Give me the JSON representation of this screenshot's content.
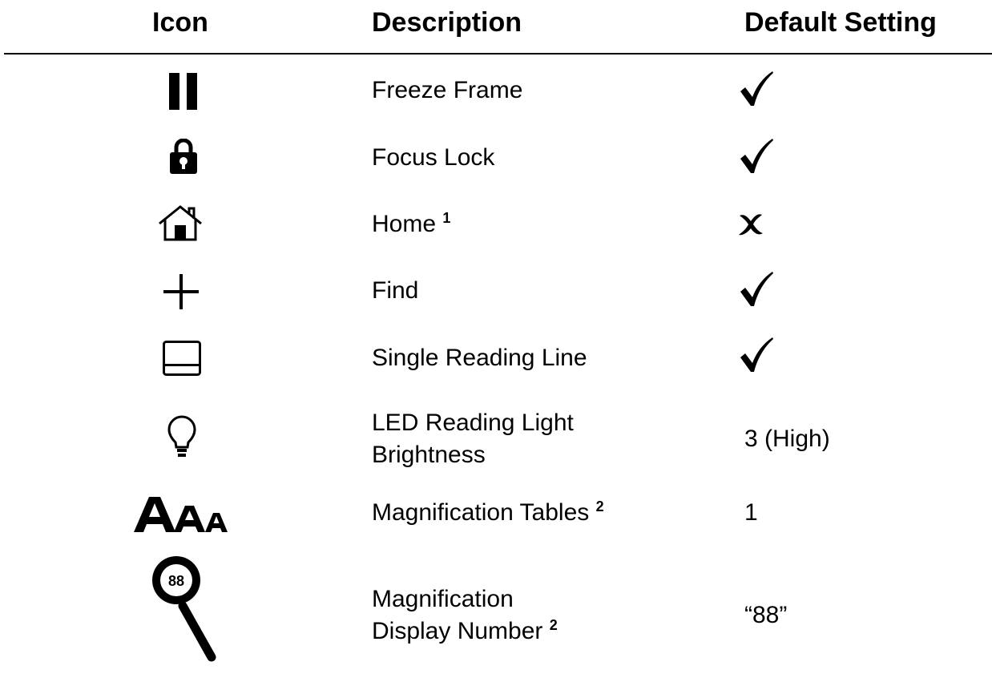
{
  "table": {
    "headers": {
      "icon": "Icon",
      "description": "Description",
      "default": "Default Setting"
    },
    "rows": [
      {
        "icon": "pause-icon",
        "description": "Freeze Frame",
        "footnote": "",
        "default": "check"
      },
      {
        "icon": "lock-icon",
        "description": "Focus Lock",
        "footnote": "",
        "default": "check"
      },
      {
        "icon": "home-icon",
        "description": "Home",
        "footnote": "1",
        "default": "cross"
      },
      {
        "icon": "crosshair-icon",
        "description": "Find",
        "footnote": "",
        "default": "check"
      },
      {
        "icon": "reading-line-icon",
        "description": "Single Reading Line",
        "footnote": "",
        "default": "check"
      },
      {
        "icon": "lightbulb-icon",
        "description_line1": "LED Reading Light",
        "description_line2": "Brightness",
        "default": "3 (High)"
      },
      {
        "icon": "font-size-icon",
        "description": "Magnification Tables",
        "footnote": "2",
        "default": "1"
      },
      {
        "icon": "magnifier-88-icon",
        "description_line1": "Magnification",
        "description_line2": "Display Number",
        "footnote": "2",
        "default": "“88”",
        "icon_text": "88"
      }
    ]
  }
}
